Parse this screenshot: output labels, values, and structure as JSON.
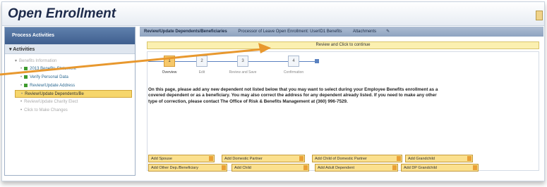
{
  "window": {
    "title": "Open Enrollment"
  },
  "sidebar": {
    "header": "Process Activities",
    "section": "Activities",
    "group": "Benefits Information",
    "items": [
      {
        "label": "2013 Benefits Statement",
        "state": "done"
      },
      {
        "label": "Verify Personal Data",
        "state": "done"
      },
      {
        "label": "Review/Update Address",
        "state": "done"
      },
      {
        "label": "Review/Update Dependents/Be",
        "state": "active"
      },
      {
        "label": "Review/Update Charity Elect",
        "state": "pending"
      },
      {
        "label": "Click to Make Changes",
        "state": "pending"
      }
    ]
  },
  "main": {
    "header_title": "Review/Update Dependents/Beneficiaries",
    "header_process": "Processor of Leave Open Enrollment: UserID1 Benefits",
    "header_attachments": "Attachments",
    "review_bar": "Review and Click to continue",
    "steps": [
      {
        "number": "1",
        "label": "Overview",
        "current": true
      },
      {
        "number": "2",
        "label": "Edit",
        "current": false
      },
      {
        "number": "3",
        "label": "Review and Save",
        "current": false
      },
      {
        "number": "4",
        "label": "Confirmation",
        "current": false
      }
    ],
    "instructions": "On this page, please add any new dependent not listed below that you may want to select during your Employee Benefits enrollment as a covered dependent or as a beneficiary. You may also correct the address for any dependent already listed. If you need to make any other type of correction, please contact The Office of Risk & Benefits Management at (360) 996-7529.",
    "buttons_row1": [
      "Add Spouse",
      "Add Domestic Partner",
      "Add Child of Domestic Partner",
      "Add Grandchild"
    ],
    "buttons_row2": [
      "Add Other Dep./Beneficiary",
      "Add Child",
      "Add Adult Dependent",
      "Add DP Grandchild"
    ]
  },
  "colors": {
    "accent": "#f6c86a",
    "sidebar_header": "#4a6a98",
    "callout_arrow": "#e8982e"
  }
}
